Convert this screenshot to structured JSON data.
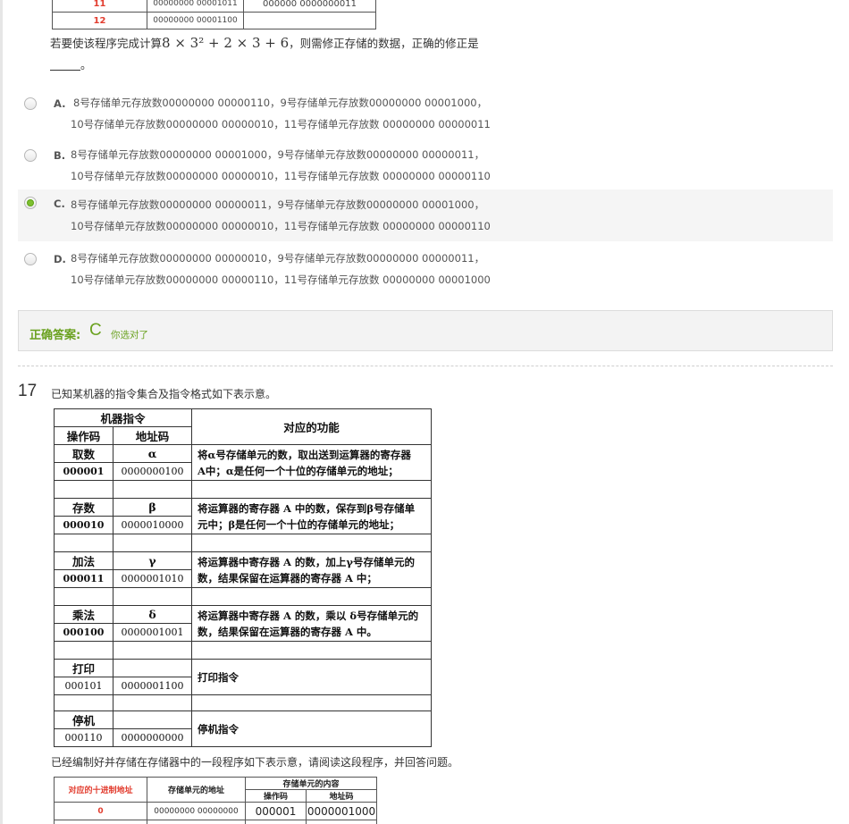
{
  "prev_table": {
    "rows": [
      {
        "dec": "11",
        "addr": "00000000 00001011",
        "content": "000000 0000000011"
      },
      {
        "dec": "12",
        "addr": "00000000 00001100",
        "content": ""
      }
    ]
  },
  "question16": {
    "stem_before": "若要使该程序完成计算",
    "stem_math": "8 × 3² + 2 × 3 + 6",
    "stem_after": "，则需修正存储的数据，正确的修正是",
    "stem_end": "。",
    "options": [
      {
        "letter": "A.",
        "line1": "8号存储单元存放数00000000 00000110，9号存储单元存放数00000000 00001000，",
        "line2": "10号存储单元存放数00000000 00000010，11号存储单元存放数 00000000 00000011",
        "selected": false
      },
      {
        "letter": "B.",
        "line1": "8号存储单元存放数00000000 00001000，9号存储单元存放数00000000 00000011，",
        "line2": "10号存储单元存放数00000000 00000010，11号存储单元存放数 00000000 00000110",
        "selected": false
      },
      {
        "letter": "C.",
        "line1": "8号存储单元存放数00000000 00000011，9号存储单元存放数00000000 00001000，",
        "line2": "10号存储单元存放数00000000 00000010，11号存储单元存放数 00000000 00000110",
        "selected": true
      },
      {
        "letter": "D.",
        "line1": "8号存储单元存放数00000000 00000010，9号存储单元存放数00000000 00000011，",
        "line2": "10号存储单元存放数00000000 00000110，11号存储单元存放数 00000000 00001000",
        "selected": false
      }
    ],
    "answer_label": "正确答案:",
    "answer_letter": "C",
    "answer_note": "你选对了"
  },
  "question17": {
    "number": "17",
    "text": "已知某机器的指令集合及指令格式如下表示意。",
    "table_head": {
      "machine_instr": "机器指令",
      "opcode": "操作码",
      "address": "地址码",
      "function": "对应的功能"
    },
    "instructions": [
      {
        "name": "取数",
        "sym": "α",
        "opcode": "000001",
        "addr": "0000000100",
        "bold_code": true,
        "func1": "将α号存储单元的数，取出送到运算器的寄存器",
        "func2": "A中；α是任何一个十位的存储单元的地址；"
      },
      {
        "name": "存数",
        "sym": "β",
        "opcode": "000010",
        "addr": "0000010000",
        "bold_code": true,
        "func1": "将运算器的寄存器 A 中的数，保存到β号存储单",
        "func2": "元中；β是任何一个十位的存储单元的地址；"
      },
      {
        "name": "加法",
        "sym": "γ",
        "opcode": "000011",
        "addr": "0000001010",
        "bold_code": true,
        "func1": "将运算器中寄存器 A 的数，加上γ号存储单元的",
        "func2": "数，结果保留在运算器的寄存器 A 中；"
      },
      {
        "name": "乘法",
        "sym": "δ",
        "opcode": "000100",
        "addr": "0000001001",
        "bold_code": true,
        "func1": "将运算器中寄存器 A 的数，乘以 δ号存储单元的",
        "func2": "数，结果保留在运算器的寄存器 A 中。"
      },
      {
        "name": "打印",
        "sym": "",
        "opcode": "000101",
        "addr": "0000001100",
        "bold_code": false,
        "func1": "打印指令",
        "func2": ""
      },
      {
        "name": "停机",
        "sym": "",
        "opcode": "000110",
        "addr": "0000000000",
        "bold_code": false,
        "func1": "停机指令",
        "func2": ""
      }
    ],
    "text2": "已经编制好并存储在存储器中的一段程序如下表示意，请阅读这段程序，并回答问题。",
    "prog_head": {
      "dec": "对应的十进制地址",
      "addr": "存储单元的地址",
      "content": "存储单元的内容",
      "opcode": "操作码",
      "address": "地址码"
    },
    "prog_rows": [
      {
        "dec": "0",
        "addr": "00000000 00000000",
        "opcode": "000001",
        "address": "0000001000"
      }
    ]
  }
}
